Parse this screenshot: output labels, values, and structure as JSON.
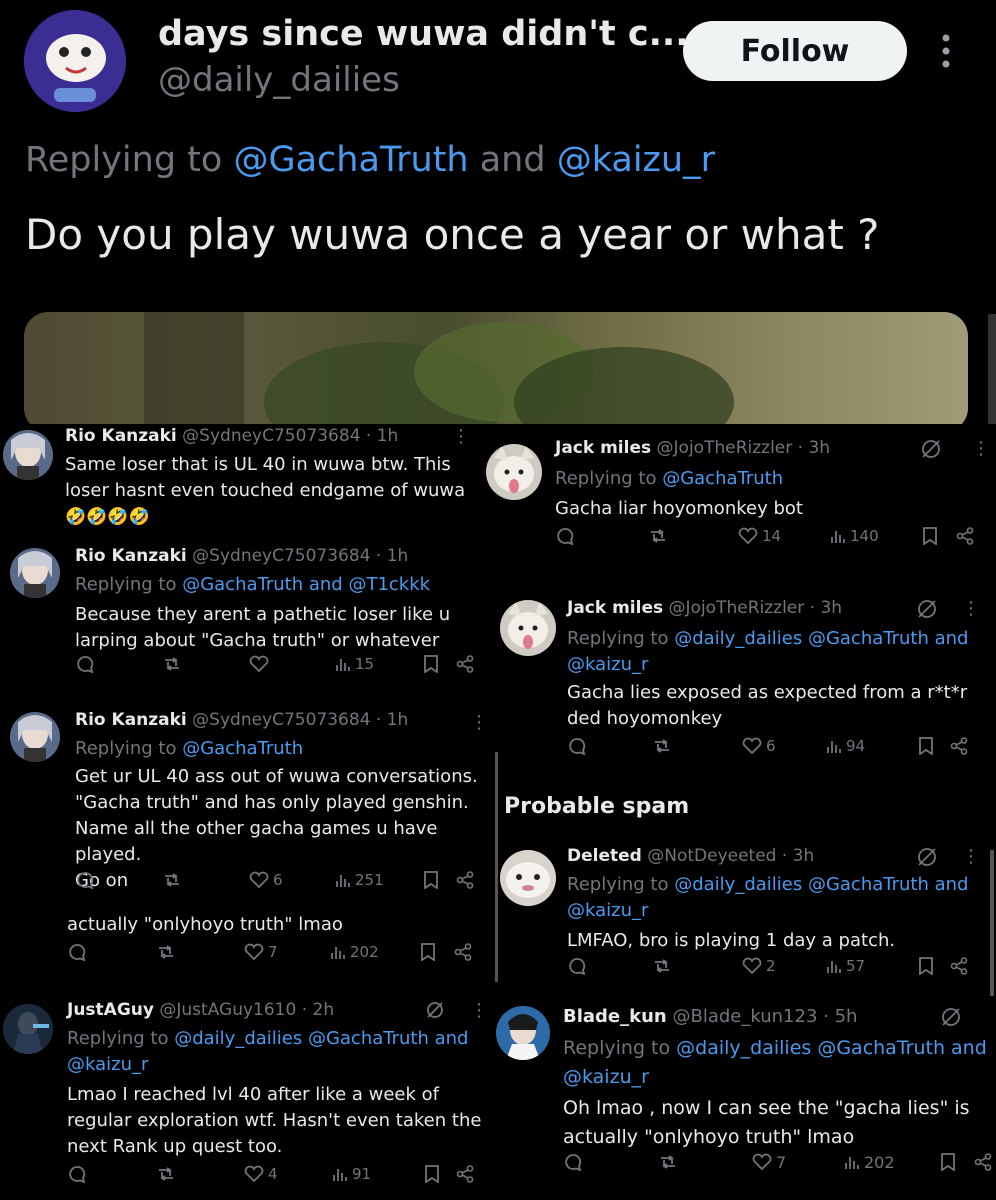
{
  "top": {
    "display_name": "days since wuwa didn't c...",
    "handle": "@daily_dailies",
    "follow_label": "Follow",
    "replying_prefix": "Replying to ",
    "replying_user1": "@GachaTruth",
    "replying_and": " and ",
    "replying_user2": "@kaizu_r",
    "text": "Do you play wuwa once a year or what ?"
  },
  "tweets": [
    {
      "name": "Rio Kanzaki",
      "handle": "@SydneyC75073684",
      "time": "· 1h",
      "text1": "Same loser that is UL 40 in wuwa btw. This",
      "text2": "loser hasnt even touched endgame of wuwa",
      "emoji": "🤣🤣🤣🤣"
    },
    {
      "name": "Rio Kanzaki",
      "handle": "@SydneyC75073684",
      "time": "· 1h",
      "reply_prefix": "Replying to ",
      "reply_users": "@GachaTruth and @T1ckkk",
      "text1": "Because they arent a pathetic loser like u",
      "text2": "larping about \"Gacha truth\" or whatever",
      "views": "15"
    },
    {
      "name": "Rio Kanzaki",
      "handle": "@SydneyC75073684",
      "time": "· 1h",
      "reply_prefix": "Replying to ",
      "reply_users": "@GachaTruth",
      "text1": "Get ur UL 40 ass out of wuwa conversations.",
      "text2": "\"Gacha truth\" and has only played genshin.",
      "text3": "Name all the other gacha games u have played.",
      "text4": "Go on",
      "likes": "6",
      "views": "251"
    },
    {
      "text": "actually \"onlyhoyo truth\" lmao",
      "likes": "7",
      "views": "202"
    },
    {
      "name": "JustAGuy",
      "handle": "@JustAGuy1610",
      "time": "· 2h",
      "reply_prefix": "Replying to ",
      "reply_users": "@daily_dailies @GachaTruth and",
      "reply_users2": "@kaizu_r",
      "text1": "Lmao I reached lvl 40 after like a week of",
      "text2": "regular exploration wtf. Hasn't even taken the",
      "text3": "next Rank up quest too.",
      "likes": "4",
      "views": "91"
    },
    {
      "name": "Jack miles",
      "handle": "@JojoTheRizzler",
      "time": "· 3h",
      "reply_prefix": "Replying to ",
      "reply_users": "@GachaTruth",
      "text1": "Gacha liar hoyomonkey bot",
      "likes": "14",
      "views": "140"
    },
    {
      "name": "Jack miles",
      "handle": "@JojoTheRizzler",
      "time": "· 3h",
      "reply_prefix": "Replying to ",
      "reply_users": "@daily_dailies @GachaTruth and",
      "reply_users2": "@kaizu_r",
      "text1": "Gacha lies exposed as expected from a r*t*r",
      "text2": "ded hoyomonkey",
      "likes": "6",
      "views": "94"
    },
    {
      "name": "Deleted",
      "handle": "@NotDeyeeted",
      "time": "· 3h",
      "reply_prefix": "Replying to ",
      "reply_users": "@daily_dailies @GachaTruth and",
      "reply_users2": "@kaizu_r",
      "text1": "LMFAO, bro is playing 1 day a patch.",
      "likes": "2",
      "views": "57"
    },
    {
      "name": "Blade_kun",
      "handle": "@Blade_kun123",
      "time": "· 5h",
      "reply_prefix": "Replying to ",
      "reply_users": "@daily_dailies @GachaTruth and",
      "reply_users2": "@kaizu_r",
      "text1": "Oh lmao , now I can see the \"gacha lies\" is",
      "text2": "actually \"onlyhoyo truth\" lmao",
      "likes": "7",
      "views": "202"
    }
  ],
  "spam_label": "Probable spam",
  "colors": {
    "link": "#4a9bef",
    "muted": "#71767b",
    "text": "#e7e9ea",
    "bg": "#000000"
  }
}
